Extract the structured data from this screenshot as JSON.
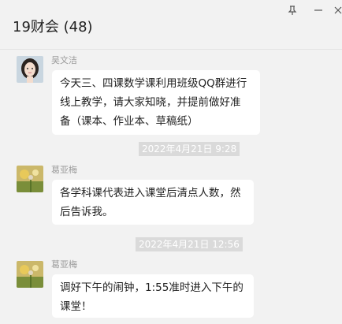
{
  "window": {
    "title": "19财会 (48)",
    "pin_icon": "pin-icon",
    "minimize_icon": "minimize-icon",
    "close_icon": "close-icon"
  },
  "messages": [
    {
      "sender": "吴文洁",
      "avatar": "girl-avatar",
      "lines": [
        "今天三、四课数学课利用班级QQ群进行",
        "线上教学，请大家知晓，并提前做好准",
        "备（课本、作业本、草稿纸）"
      ]
    },
    {
      "timestamp": "2022年4月21日 9:28"
    },
    {
      "sender": "葛亚梅",
      "avatar": "flower-avatar",
      "lines": [
        "各学科课代表进入课堂后清点人数，然",
        "后告诉我。"
      ]
    },
    {
      "timestamp": "2022年4月21日 12:56"
    },
    {
      "sender": "葛亚梅",
      "avatar": "flower-avatar",
      "lines": [
        "调好下午的闹钟，1:55准时进入下午的",
        "课堂！"
      ]
    }
  ]
}
